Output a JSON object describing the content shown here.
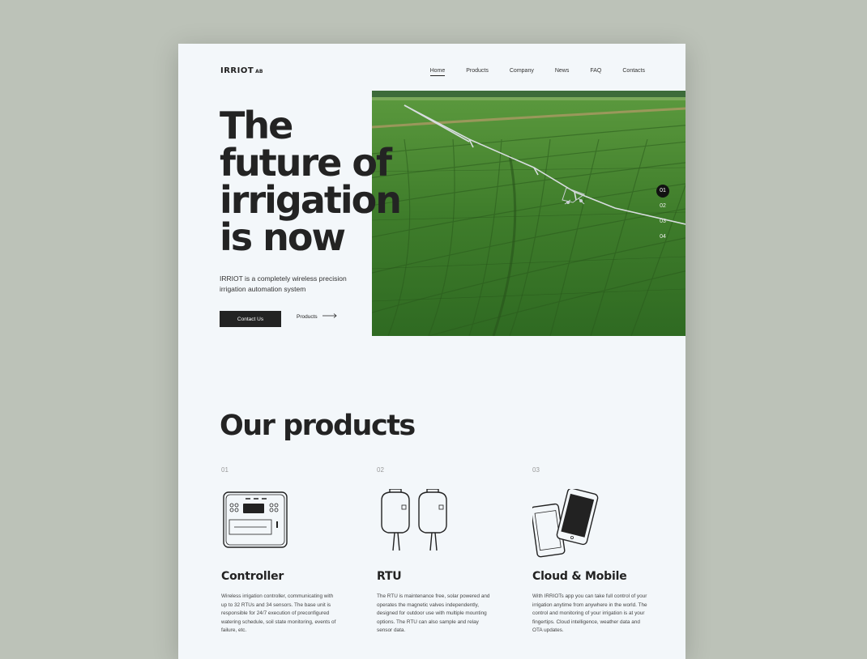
{
  "header": {
    "logo": "IRRIOT",
    "logo_suffix": "AB",
    "nav": [
      "Home",
      "Products",
      "Company",
      "News",
      "FAQ",
      "Contacts"
    ]
  },
  "hero": {
    "title": "The\nfuture of\nirrigation\nis now",
    "subtitle": "IRRIOT is a completely wireless precision irrigation automation system",
    "cta_primary": "Contact Us",
    "cta_secondary": "Products",
    "slides": [
      "01",
      "02",
      "03",
      "04"
    ],
    "active_slide": "01"
  },
  "products_section": {
    "title": "Our products",
    "items": [
      {
        "number": "01",
        "icon": "controller-icon",
        "name": "Controller",
        "description": "Wireless irrigation controller, communicating with up to 32 RTUs and 34 sensors. The base unit is responsible for 24/7 execution of preconfigured watering schedule, soil state monitoring, events of failure, etc."
      },
      {
        "number": "02",
        "icon": "rtu-icon",
        "name": "RTU",
        "description": "The RTU is maintenance free, solar powered and operates the magnetic valves independently, designed for outdoor use with multiple mounting options. The RTU can also sample and relay sensor data."
      },
      {
        "number": "03",
        "icon": "mobile-devices-icon",
        "name": "Cloud & Mobile",
        "description": "With IRRIOTs app you can take full control of your irrigation anytime from anywhere in the world. The control and monitoring of your irrigation is at your fingertips. Cloud intelligence, weather data and OTA updates."
      }
    ]
  },
  "colors": {
    "background": "#bcc2b8",
    "page": "#f3f7fa",
    "dark": "#232323",
    "field_green": "#3f7a2c"
  }
}
